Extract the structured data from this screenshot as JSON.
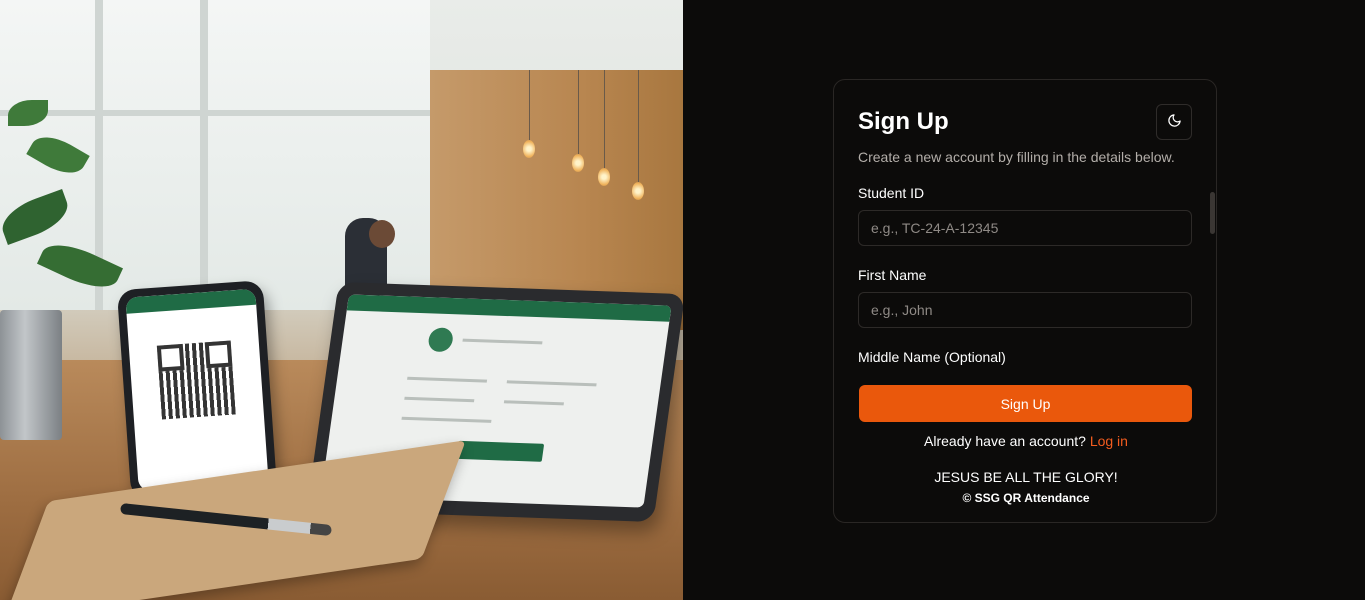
{
  "hero_image": {
    "alt": "QR attendance setup with phone and tablet on a desk"
  },
  "auth": {
    "title": "Sign Up",
    "subtitle": "Create a new account by filling in the details below.",
    "theme_toggle_icon": "moon-icon",
    "fields": [
      {
        "label": "Student ID",
        "placeholder": "e.g., TC-24-A-12345",
        "value": ""
      },
      {
        "label": "First Name",
        "placeholder": "e.g., John",
        "value": ""
      },
      {
        "label": "Middle Name (Optional)",
        "placeholder": "",
        "value": ""
      }
    ],
    "submit_label": "Sign Up",
    "login_prompt": "Already have an account?",
    "login_link": "Log in",
    "footer_motto": "JESUS BE ALL THE GLORY!",
    "footer_copyright": "© SSG QR Attendance"
  },
  "colors": {
    "background": "#0c0b0a",
    "accent": "#ea580c",
    "link": "#f25c1f",
    "border": "#2d2a28",
    "muted_text": "#b3aea9"
  }
}
